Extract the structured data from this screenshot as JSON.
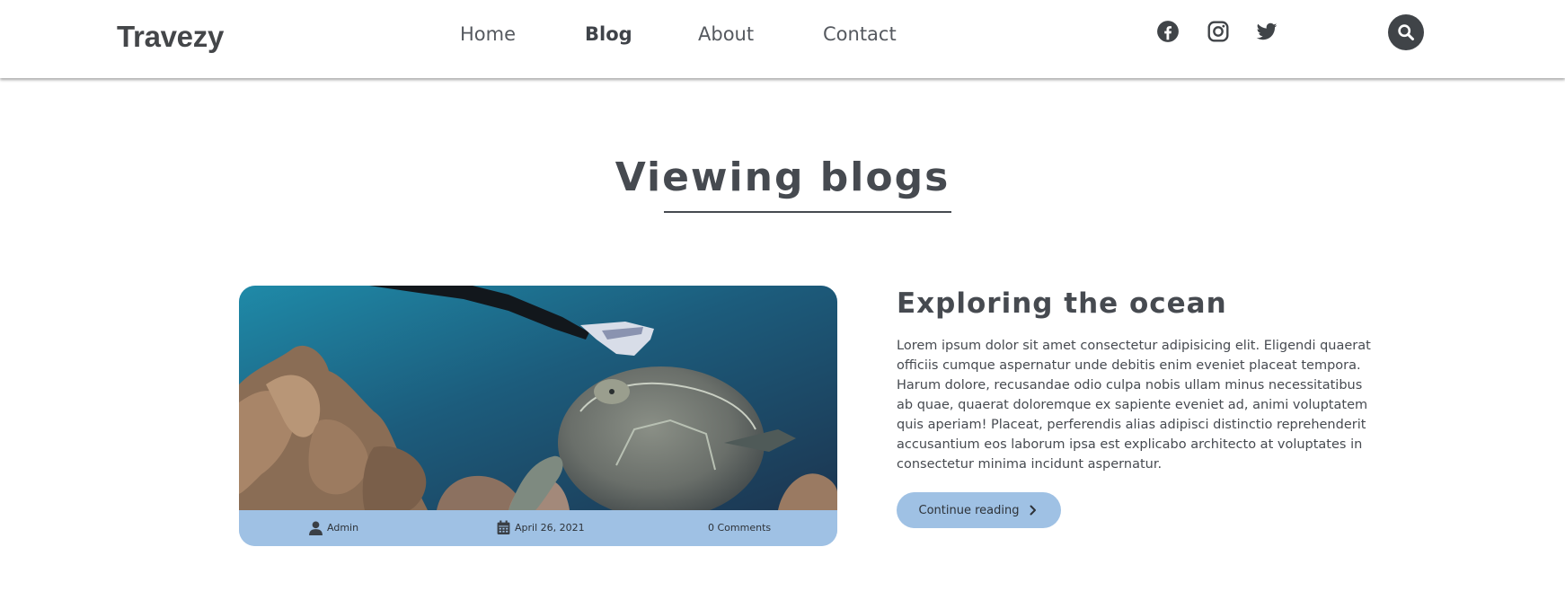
{
  "header": {
    "logo": "Travezy",
    "nav": [
      {
        "label": "Home",
        "active": false
      },
      {
        "label": "Blog",
        "active": true
      },
      {
        "label": "About",
        "active": false
      },
      {
        "label": "Contact",
        "active": false
      }
    ],
    "social_icons": [
      "facebook-icon",
      "instagram-icon",
      "twitter-icon"
    ],
    "search_icon": "search-icon"
  },
  "page": {
    "title": "Viewing blogs"
  },
  "post": {
    "title": "Exploring the ocean",
    "excerpt": "Lorem ipsum dolor sit amet consectetur adipisicing elit. Eligendi quaerat officiis cumque aspernatur unde debitis enim eveniet placeat tempora. Harum dolore, recusandae odio culpa nobis ullam minus necessitatibus ab quae, quaerat doloremque ex sapiente eveniet ad, animi voluptatem quis aperiam! Placeat, perferendis alias adipisci distinctio reprehenderit accusantium eos laborum ipsa est explicabo architecto at voluptates in consectetur minima incidunt aspernatur.",
    "author": "Admin",
    "date": "April 26, 2021",
    "comments": "0 Comments",
    "read_more_label": "Continue reading"
  },
  "colors": {
    "accent": "#9fc1e4",
    "text": "#464a50",
    "dark": "#404448"
  }
}
